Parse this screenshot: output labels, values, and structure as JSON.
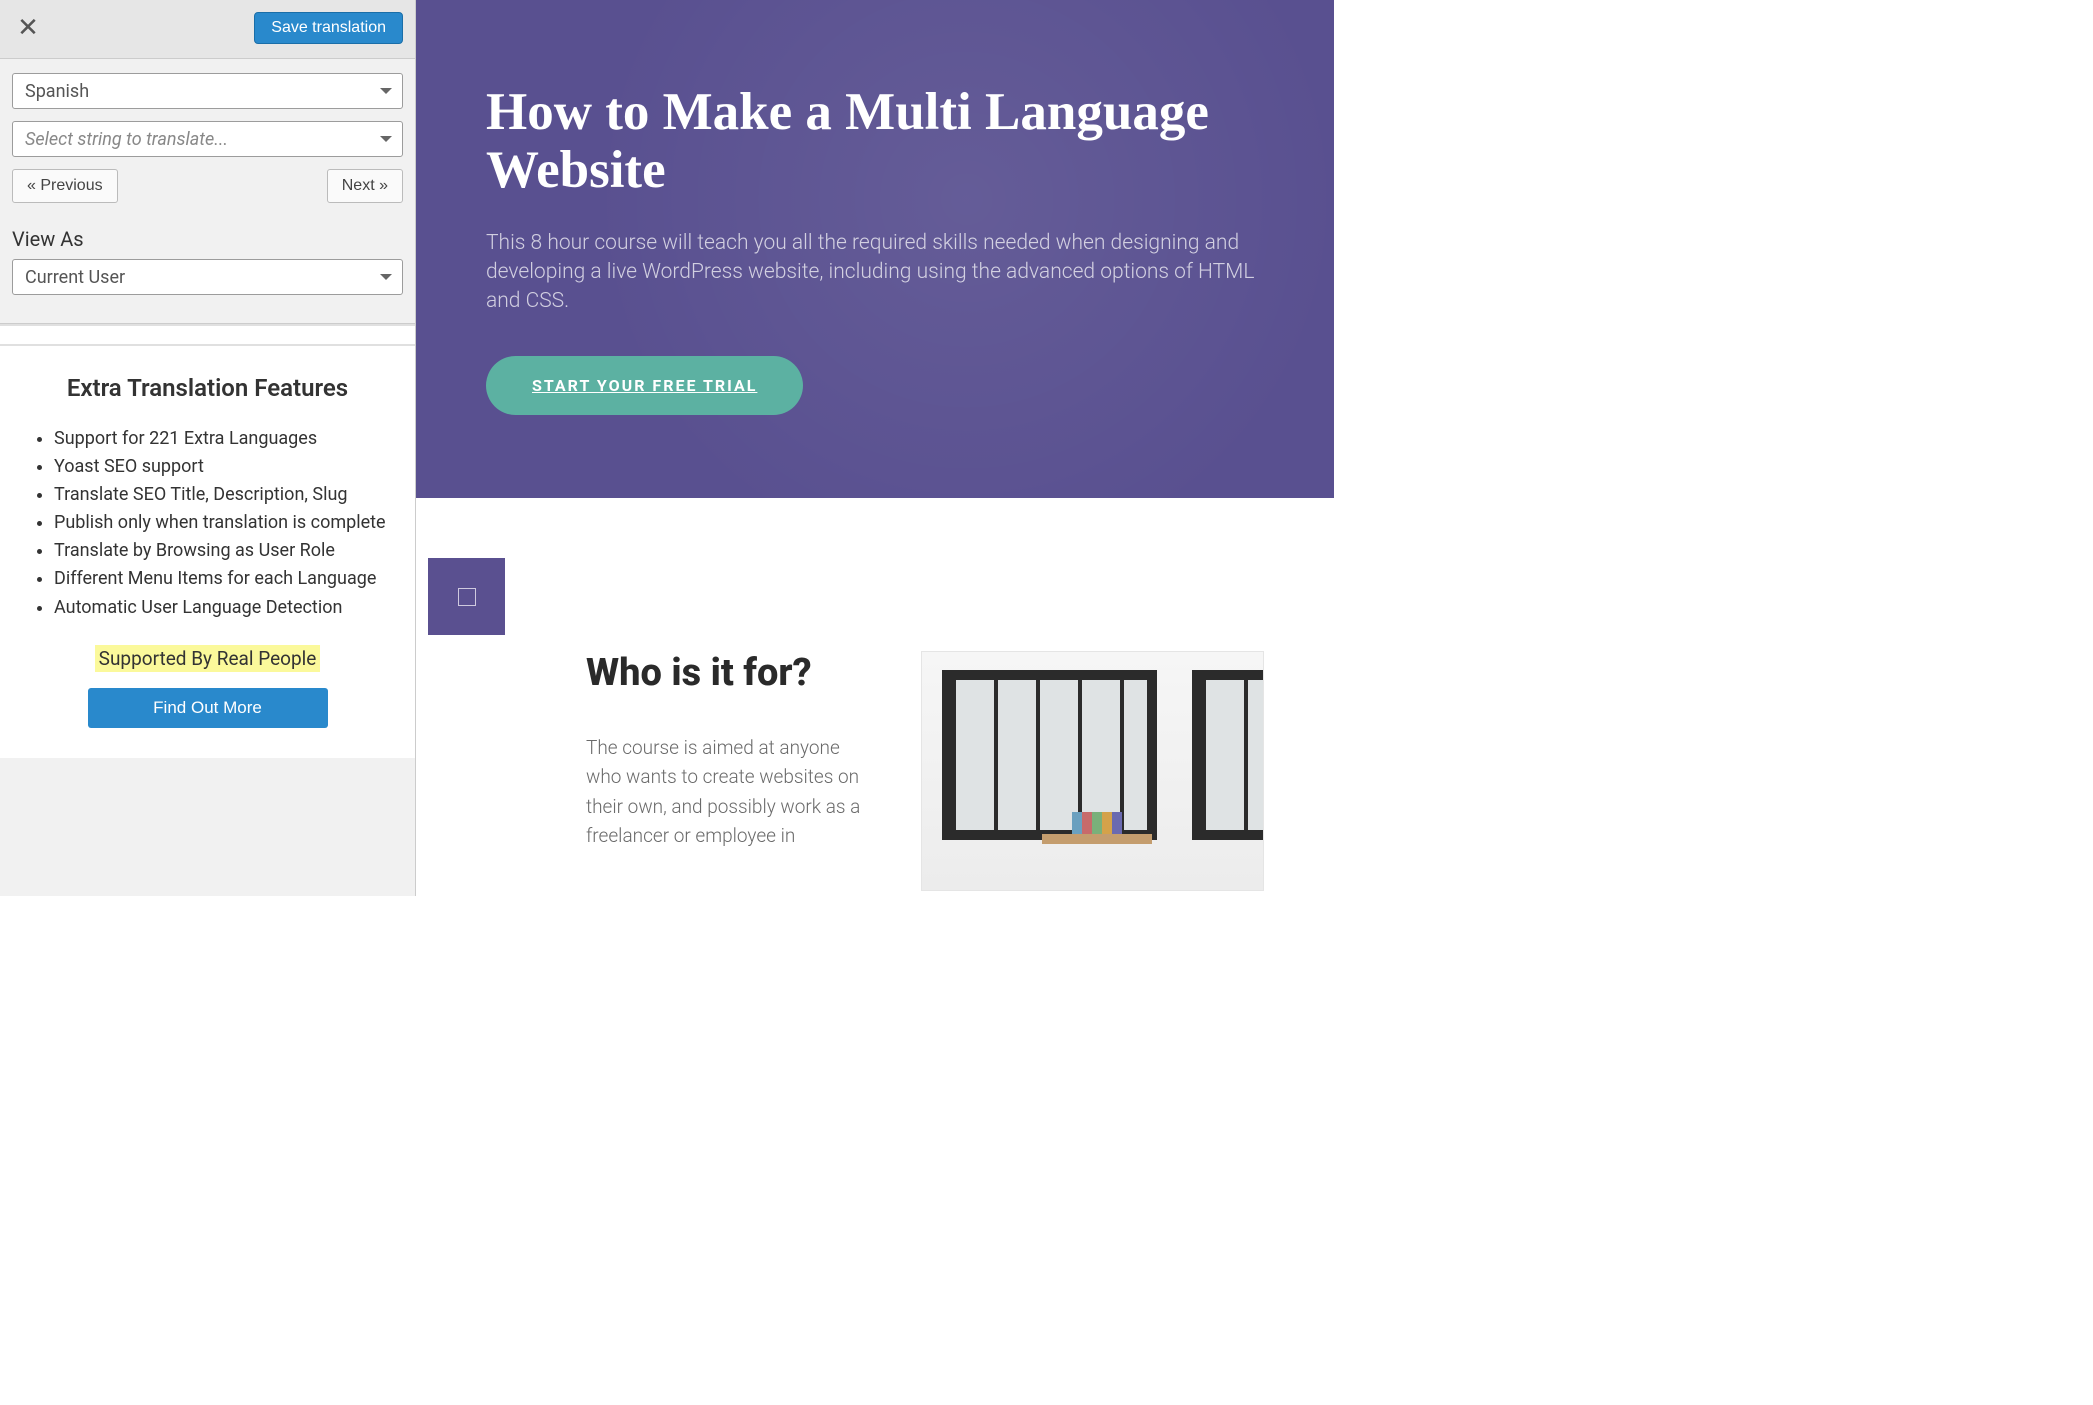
{
  "sidebar": {
    "save_label": "Save translation",
    "language_select": "Spanish",
    "string_select_placeholder": "Select string to translate...",
    "prev_label": "« Previous",
    "next_label": "Next »",
    "view_as_label": "View As",
    "view_as_value": "Current User",
    "features_heading": "Extra Translation Features",
    "features": [
      "Support for 221 Extra Languages",
      "Yoast SEO support",
      "Translate SEO Title, Description, Slug",
      "Publish only when translation is complete",
      "Translate by Browsing as User Role",
      "Different Menu Items for each Language",
      "Automatic User Language Detection"
    ],
    "supported_text": "Supported By Real People",
    "find_out_label": "Find Out More"
  },
  "preview": {
    "hero_title": "How to Make a Multi Language Website",
    "hero_body": "This 8 hour course will teach you all the required skills needed when designing and developing a live WordPress website, including using the advanced options of HTML and CSS.",
    "cta_label": "START YOUR FREE TRIAL",
    "who_heading": "Who is it for?",
    "who_body": "The course is aimed at anyone who wants to create websites on their own, and possibly work as a freelancer or employee in"
  }
}
